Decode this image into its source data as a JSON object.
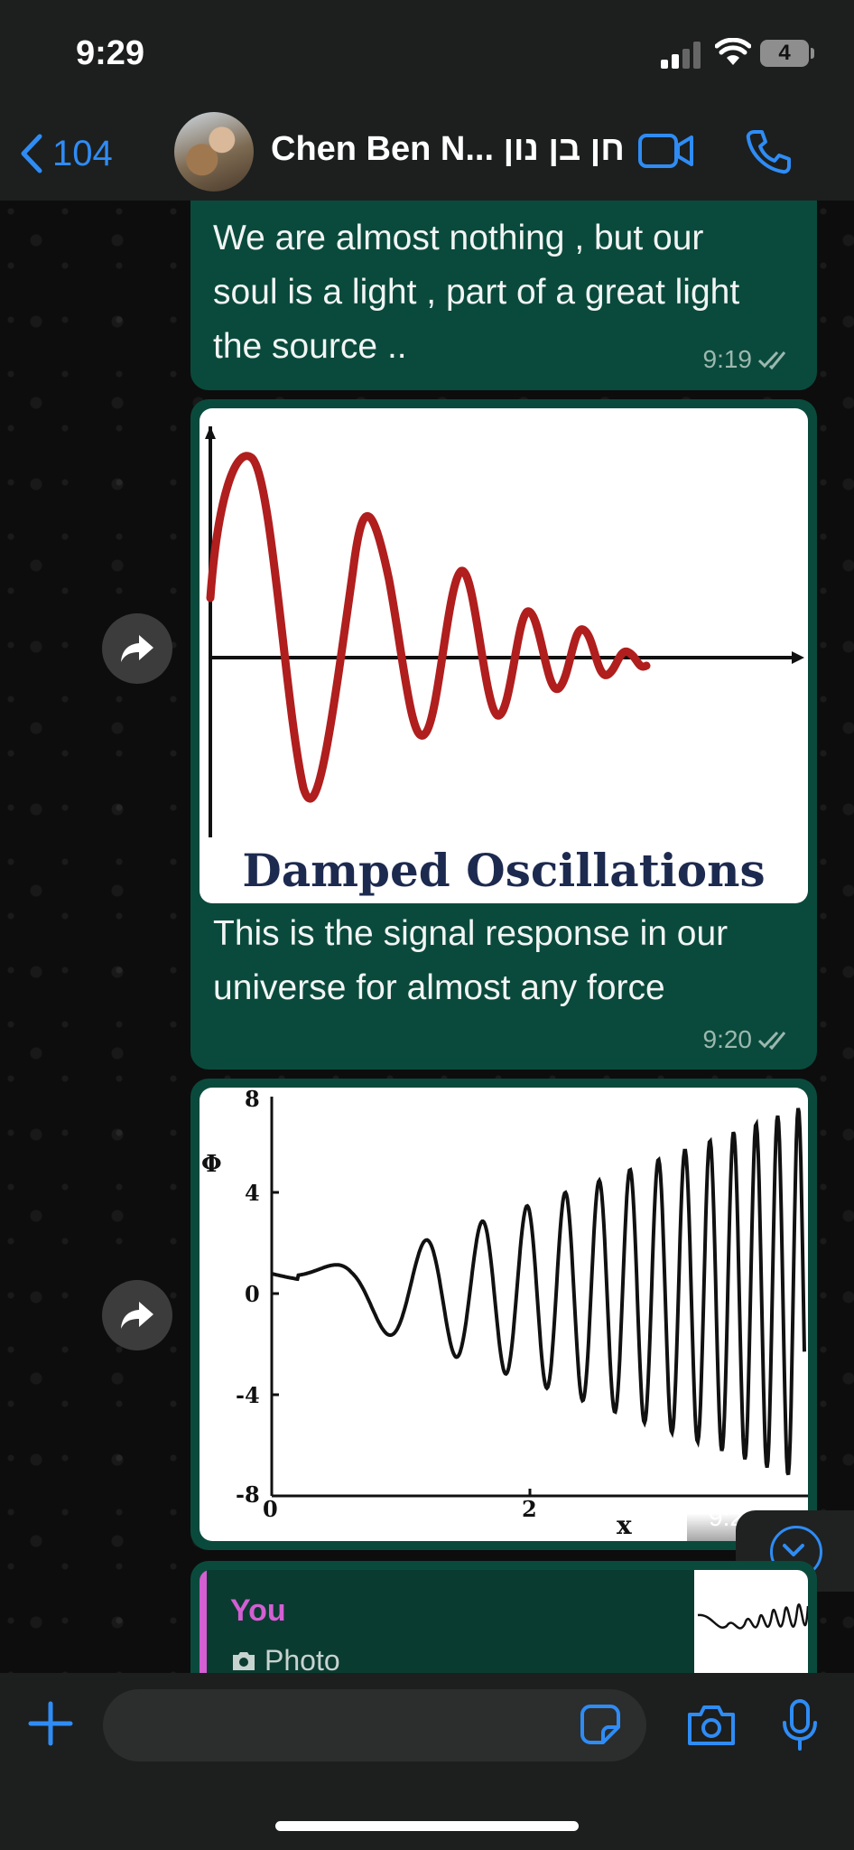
{
  "status_bar": {
    "time": "9:29",
    "battery": "4"
  },
  "header": {
    "back_count": "104",
    "contact_name": "Chen Ben N... חן בן נון",
    "icons": [
      "chevron-left-icon",
      "video-camera-icon",
      "phone-icon"
    ]
  },
  "messages": [
    {
      "text_lines": [
        "We are almost nothing , but our",
        "soul is a light , part of a great light",
        "the source .."
      ],
      "time": "9:19"
    },
    {
      "image_caption": "Damped Oscillations",
      "text_lines": [
        "This is the signal response in our",
        "universe for almost any force"
      ],
      "time": "9:20"
    },
    {
      "graph": {
        "y_label": "Φ",
        "x_label": "x",
        "y_ticks": [
          "8",
          "4",
          "0",
          "-4",
          "-8"
        ],
        "x_ticks": [
          "0",
          "2"
        ]
      },
      "time": "9:2"
    }
  ],
  "reply_preview": {
    "author": "You",
    "type": "Photo"
  },
  "input": {
    "placeholder": ""
  },
  "colors": {
    "accent": "#2f8cf5",
    "bubble": "#0a4a3c",
    "reply_author": "#d35fd3"
  }
}
